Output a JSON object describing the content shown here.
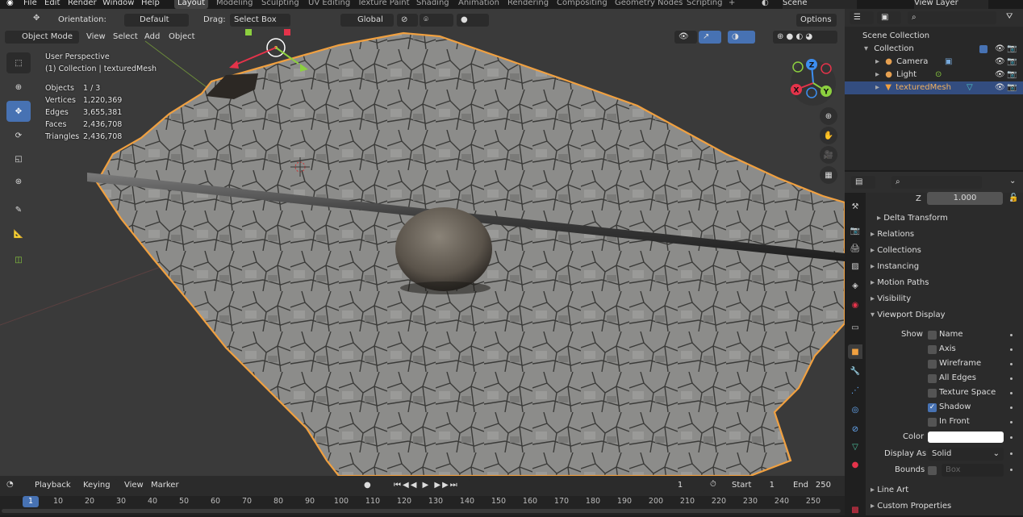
{
  "menu": {
    "file": "File",
    "edit": "Edit",
    "render": "Render",
    "window": "Window",
    "help": "Help"
  },
  "workspaces": [
    "Layout",
    "Modeling",
    "Sculpting",
    "UV Editing",
    "Texture Paint",
    "Shading",
    "Animation",
    "Rendering",
    "Compositing",
    "Geometry Nodes",
    "Scripting"
  ],
  "scene": {
    "name": "Scene",
    "view_layer": "View Layer"
  },
  "tool_header": {
    "orientation_label": "Orientation:",
    "orientation_value": "Default",
    "drag_label": "Drag:",
    "drag_value": "Select Box",
    "transform_orientation": "Global",
    "options": "Options"
  },
  "viewport_header": {
    "mode": "Object Mode",
    "view": "View",
    "select": "Select",
    "add": "Add",
    "object": "Object"
  },
  "overlay_text": {
    "perspective": "User Perspective",
    "collection": "(1) Collection | texturedMesh"
  },
  "stats": [
    {
      "label": "Objects",
      "value": "1 / 3"
    },
    {
      "label": "Vertices",
      "value": "1,220,369"
    },
    {
      "label": "Edges",
      "value": "3,655,381"
    },
    {
      "label": "Faces",
      "value": "2,436,708"
    },
    {
      "label": "Triangles",
      "value": "2,436,708"
    }
  ],
  "gizmo_axes": {
    "x": "X",
    "y": "Y",
    "z": "Z"
  },
  "outliner": {
    "scene_collection": "Scene Collection",
    "collection": "Collection",
    "items": [
      {
        "label": "Camera",
        "selected": false
      },
      {
        "label": "Light",
        "selected": false
      },
      {
        "label": "texturedMesh",
        "selected": true
      }
    ]
  },
  "properties": {
    "z_label": "Z",
    "z_value": "1.000",
    "delta_transform": "Delta Transform",
    "panels": [
      "Relations",
      "Collections",
      "Instancing",
      "Motion Paths",
      "Visibility",
      "Viewport Display"
    ],
    "show_label": "Show",
    "show_options": [
      {
        "label": "Name",
        "checked": false
      },
      {
        "label": "Axis",
        "checked": false
      },
      {
        "label": "Wireframe",
        "checked": false
      },
      {
        "label": "All Edges",
        "checked": false
      },
      {
        "label": "Texture Space",
        "checked": false
      },
      {
        "label": "Shadow",
        "checked": true
      },
      {
        "label": "In Front",
        "checked": false
      }
    ],
    "color_label": "Color",
    "color_value": "#ffffff",
    "display_as_label": "Display As",
    "display_as_value": "Solid",
    "bounds_label": "Bounds",
    "bounds_value": "Box",
    "line_art": "Line Art",
    "custom_properties": "Custom Properties"
  },
  "timeline": {
    "playback": "Playback",
    "keying": "Keying",
    "view": "View",
    "marker": "Marker",
    "current_frame": "1",
    "start_label": "Start",
    "start_value": "1",
    "end_label": "End",
    "end_value": "250",
    "ruler": [
      "1",
      "10",
      "20",
      "30",
      "40",
      "50",
      "60",
      "70",
      "80",
      "90",
      "100",
      "110",
      "120",
      "130",
      "140",
      "150",
      "160",
      "170",
      "180",
      "190",
      "200",
      "210",
      "220",
      "230",
      "240",
      "250"
    ]
  },
  "colors": {
    "accent": "#4772b3",
    "selection_outline": "#f0a040",
    "x_axis": "#e5334a",
    "y_axis": "#8ccf3f",
    "z_axis": "#3d8ef0"
  }
}
